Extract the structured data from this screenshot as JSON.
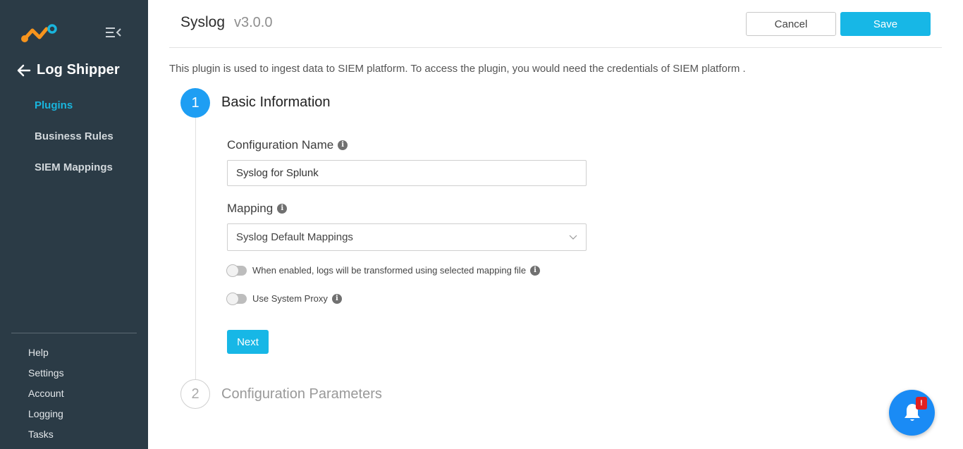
{
  "sidebar": {
    "back_label": "Log Shipper",
    "nav": [
      {
        "label": "Plugins",
        "active": true
      },
      {
        "label": "Business Rules",
        "active": false
      },
      {
        "label": "SIEM Mappings",
        "active": false
      }
    ],
    "bottom": [
      {
        "label": "Help"
      },
      {
        "label": "Settings"
      },
      {
        "label": "Account"
      },
      {
        "label": "Logging"
      },
      {
        "label": "Tasks"
      }
    ]
  },
  "header": {
    "title": "Syslog",
    "version": "v3.0.0",
    "cancel_label": "Cancel",
    "save_label": "Save",
    "description": "This plugin is used to ingest data to SIEM platform. To access the plugin, you would need the credentials of SIEM platform ."
  },
  "steps": [
    {
      "number": "1",
      "title": "Basic Information",
      "active": true
    },
    {
      "number": "2",
      "title": "Configuration Parameters",
      "active": false
    }
  ],
  "form": {
    "config_name_label": "Configuration Name",
    "config_name_value": "Syslog for Splunk",
    "mapping_label": "Mapping",
    "mapping_value": "Syslog Default Mappings",
    "toggle_transform_label": "When enabled, logs will be transformed using selected mapping file",
    "toggle_proxy_label": "Use System Proxy",
    "next_label": "Next",
    "info_glyph": "i"
  },
  "notification": {
    "badge": "!"
  },
  "colors": {
    "sidebar_bg": "#2b3b46",
    "accent": "#17b7e6",
    "active_nav": "#19b5dd",
    "step_active": "#1e9ef3",
    "fab": "#1a8bf5",
    "badge": "#e02020"
  }
}
